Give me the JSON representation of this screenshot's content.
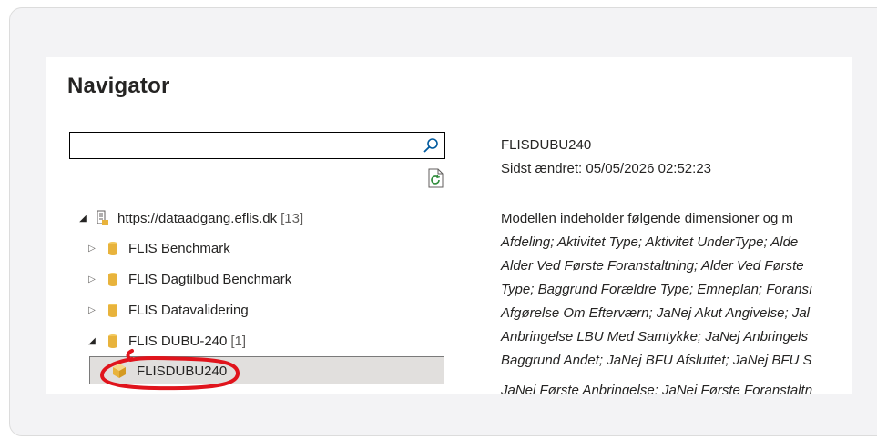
{
  "dialog": {
    "title": "Navigator"
  },
  "search": {
    "value": "",
    "placeholder": ""
  },
  "tree": {
    "root": {
      "label": "https://dataadgang.eflis.dk",
      "count": "[13]"
    },
    "items": [
      {
        "label": "FLIS Benchmark"
      },
      {
        "label": "FLIS Dagtilbud Benchmark"
      },
      {
        "label": "FLIS Datavalidering"
      },
      {
        "label": "FLIS DUBU-240",
        "count": "[1]"
      }
    ],
    "selected": {
      "label": "FLISDUBU240"
    }
  },
  "details": {
    "name": "FLISDUBU240",
    "modified": "Sidst ændret: 05/05/2026 02:52:23",
    "description_intro": "Modellen indeholder følgende dimensioner og m",
    "lines": [
      "Afdeling; Aktivitet Type; Aktivitet UnderType; Alde",
      "Alder Ved Første Foranstaltning; Alder Ved Første",
      "Type; Baggrund Forældre Type; Emneplan; Foransı",
      "Afgørelse Om Efterværn; JaNej Akut Angivelse; Jal",
      "Anbringelse LBU Med Samtykke; JaNej Anbringels",
      "Baggrund Andet; JaNej BFU Afsluttet; JaNej BFU S",
      "JaNej Første Anbringelse; JaNej Første Foranstaltn"
    ]
  },
  "colors": {
    "accent": "#0078d4",
    "database_icon": "#e8b33c",
    "annotation": "#e0141c"
  }
}
